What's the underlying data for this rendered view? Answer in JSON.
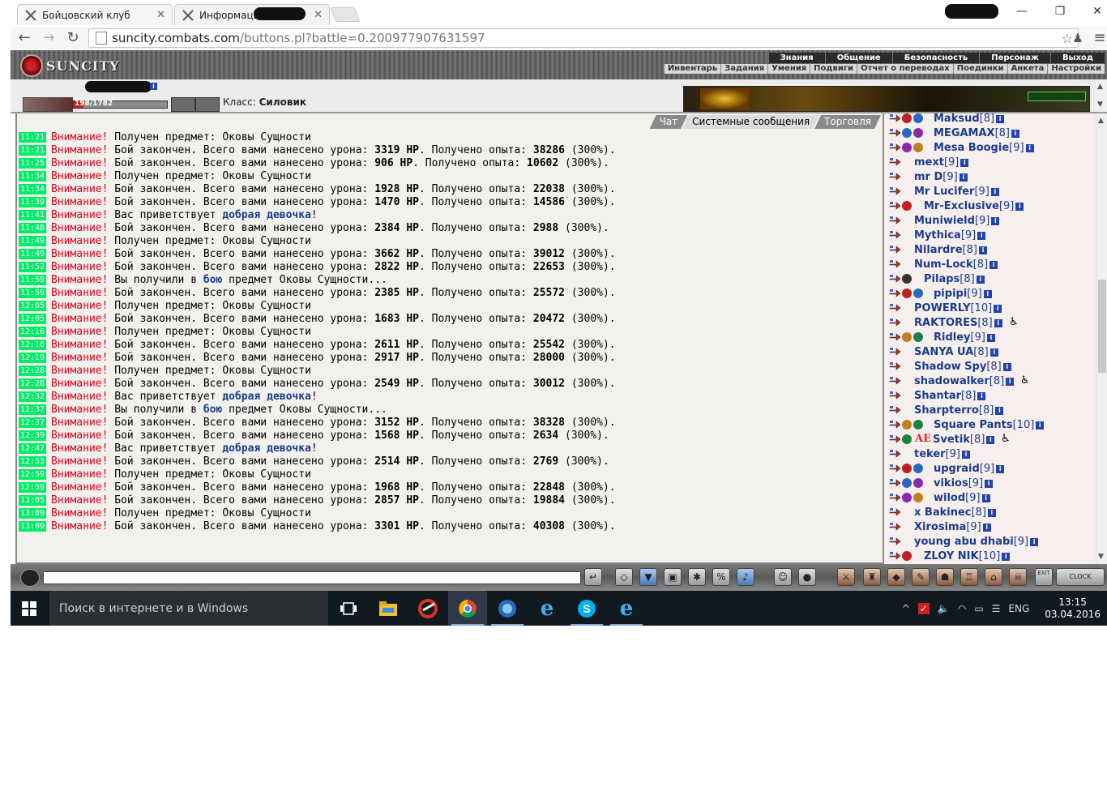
{
  "browser": {
    "tabs": [
      {
        "title": "Бойцовский клуб",
        "active": true
      },
      {
        "title": "Информация",
        "active": false
      }
    ],
    "url_host": "suncity.combats.com",
    "url_path": "/buttons.pl?battle=0.200977907631597"
  },
  "game": {
    "logo": "SUNCITY",
    "menu_main": [
      "Знания",
      "Общение",
      "Безопасность",
      "Персонаж",
      "Выход"
    ],
    "menu_sub": [
      "Инвентарь",
      "Задания",
      "Умения",
      "Подвиги",
      "Отчет о переводах",
      "Поединки",
      "Анкета",
      "Настройки"
    ],
    "hp_text": "198/1782",
    "hp_fraction": 0.111,
    "class_label": "Класс:",
    "class_value": "Силовик"
  },
  "chat": {
    "tabs": [
      "Чат",
      "Системные сообщения",
      "Торговля"
    ],
    "active_tab": "Системные сообщения",
    "warning_label": "Внимание!",
    "messages": [
      {
        "time": "11:21",
        "type": "item",
        "text": "Получен предмет: Оковы Сущности"
      },
      {
        "time": "11:21",
        "type": "battle",
        "damage": "3319 HP",
        "exp": "38286"
      },
      {
        "time": "11:25",
        "type": "battle",
        "damage": "906 HP",
        "exp": "10602"
      },
      {
        "time": "11:34",
        "type": "item",
        "text": "Получен предмет: Оковы Сущности"
      },
      {
        "time": "11:34",
        "type": "battle",
        "damage": "1928 HP",
        "exp": "22038"
      },
      {
        "time": "11:39",
        "type": "battle",
        "damage": "1470 HP",
        "exp": "14586"
      },
      {
        "time": "11:41",
        "type": "greet",
        "text": "Вас приветствует",
        "who": "добрая девочка"
      },
      {
        "time": "11:48",
        "type": "battle",
        "damage": "2384 HP",
        "exp": "2988"
      },
      {
        "time": "11:49",
        "type": "item",
        "text": "Получен предмет: Оковы Сущности"
      },
      {
        "time": "11:49",
        "type": "battle",
        "damage": "3662 HP",
        "exp": "39012"
      },
      {
        "time": "11:52",
        "type": "battle",
        "damage": "2822 HP",
        "exp": "22653"
      },
      {
        "time": "11:59",
        "type": "found",
        "pre": "Вы получили в",
        "link": "бою",
        "post": "предмет Оковы Сущности..."
      },
      {
        "time": "11:59",
        "type": "battle",
        "damage": "2385 HP",
        "exp": "25572"
      },
      {
        "time": "12:05",
        "type": "item",
        "text": "Получен предмет: Оковы Сущности"
      },
      {
        "time": "12:05",
        "type": "battle",
        "damage": "1683 HP",
        "exp": "20472"
      },
      {
        "time": "12:16",
        "type": "item",
        "text": "Получен предмет: Оковы Сущности"
      },
      {
        "time": "12:16",
        "type": "battle",
        "damage": "2611 HP",
        "exp": "25542"
      },
      {
        "time": "12:19",
        "type": "battle",
        "damage": "2917 HP",
        "exp": "28000"
      },
      {
        "time": "12:28",
        "type": "item",
        "text": "Получен предмет: Оковы Сущности"
      },
      {
        "time": "12:28",
        "type": "battle",
        "damage": "2549 HP",
        "exp": "30012"
      },
      {
        "time": "12:32",
        "type": "greet",
        "text": "Вас приветствует",
        "who": "добрая девочка"
      },
      {
        "time": "12:37",
        "type": "found",
        "pre": "Вы получили в",
        "link": "бою",
        "post": "предмет Оковы Сущности..."
      },
      {
        "time": "12:37",
        "type": "battle",
        "damage": "3152 HP",
        "exp": "38328"
      },
      {
        "time": "12:39",
        "type": "battle",
        "damage": "1568 HP",
        "exp": "2634"
      },
      {
        "time": "12:47",
        "type": "greet",
        "text": "Вас приветствует",
        "who": "добрая девочка"
      },
      {
        "time": "12:53",
        "type": "battle",
        "damage": "2514 HP",
        "exp": "2769"
      },
      {
        "time": "12:59",
        "type": "item",
        "text": "Получен предмет: Оковы Сущности"
      },
      {
        "time": "12:59",
        "type": "battle",
        "damage": "1968 HP",
        "exp": "22848"
      },
      {
        "time": "13:05",
        "type": "battle",
        "damage": "2857 HP",
        "exp": "19884"
      },
      {
        "time": "13:09",
        "type": "item",
        "text": "Получен предмет: Оковы Сущности"
      },
      {
        "time": "13:09",
        "type": "battle",
        "damage": "3301 HP",
        "exp": "40308"
      }
    ],
    "battle_pre": "Бой закончен. Всего вами нанесено урона:",
    "battle_mid": ". Получено опыта:",
    "battle_post": "(300%)."
  },
  "users": [
    {
      "name": "Maksud",
      "level": "[8]",
      "badges": 2
    },
    {
      "name": "MEGAMAX",
      "level": "[8]",
      "badges": 2
    },
    {
      "name": "Mesa Boogie",
      "level": "[9]",
      "badges": 2
    },
    {
      "name": "mext",
      "level": "[9]",
      "badges": 0
    },
    {
      "name": "mr D",
      "level": "[9]",
      "badges": 0
    },
    {
      "name": "Mr Lucifer",
      "level": "[9]",
      "badges": 0
    },
    {
      "name": "Mr-Exclusive",
      "level": "[9]",
      "badges": 1
    },
    {
      "name": "Muniwield",
      "level": "[9]",
      "badges": 0
    },
    {
      "name": "Mythica",
      "level": "[9]",
      "badges": 0
    },
    {
      "name": "Nilardre",
      "level": "[8]",
      "badges": 0
    },
    {
      "name": "Num-Lock",
      "level": "[8]",
      "badges": 0
    },
    {
      "name": "Pilaps",
      "level": "[8]",
      "badges": 1
    },
    {
      "name": "pipipi",
      "level": "[9]",
      "badges": 2
    },
    {
      "name": "POWERLY",
      "level": "[10]",
      "badges": 0
    },
    {
      "name": "RAKTORES",
      "level": "[8]",
      "badges": 0,
      "extra": true
    },
    {
      "name": "Ridley",
      "level": "[9]",
      "badges": 2
    },
    {
      "name": "SANYA UA",
      "level": "[8]",
      "badges": 0
    },
    {
      "name": "Shadow Spy",
      "level": "[8]",
      "badges": 0
    },
    {
      "name": "shadowalker",
      "level": "[8]",
      "badges": 0,
      "extra": true
    },
    {
      "name": "Shantar",
      "level": "[8]",
      "badges": 0
    },
    {
      "name": "Sharpterro",
      "level": "[8]",
      "badges": 0
    },
    {
      "name": "Square Pants",
      "level": "[10]",
      "badges": 2
    },
    {
      "name": "Svetik",
      "level": "[8]",
      "badges": 1,
      "extra": true,
      "tag": "AE"
    },
    {
      "name": "teker",
      "level": "[9]",
      "badges": 0
    },
    {
      "name": "upgraid",
      "level": "[9]",
      "badges": 2
    },
    {
      "name": "vikios",
      "level": "[9]",
      "badges": 2
    },
    {
      "name": "wilod",
      "level": "[9]",
      "badges": 2
    },
    {
      "name": "x Bakinec",
      "level": "[8]",
      "badges": 0
    },
    {
      "name": "Xirosima",
      "level": "[9]",
      "badges": 0
    },
    {
      "name": "young abu dhabi",
      "level": "[9]",
      "badges": 0
    },
    {
      "name": "ZLOY NIK",
      "level": "[10]",
      "badges": 1
    }
  ],
  "bottombar": {
    "exit_label": "EXIT",
    "clock_label": "CLOCK"
  },
  "taskbar": {
    "search_placeholder": "Поиск в интернете и в Windows",
    "lang": "ENG",
    "time": "13:15",
    "date": "03.04.2016"
  },
  "colors": {
    "timestamp_bg": "#00ee66",
    "warning": "#e0001a",
    "link": "#1a3c8a"
  }
}
